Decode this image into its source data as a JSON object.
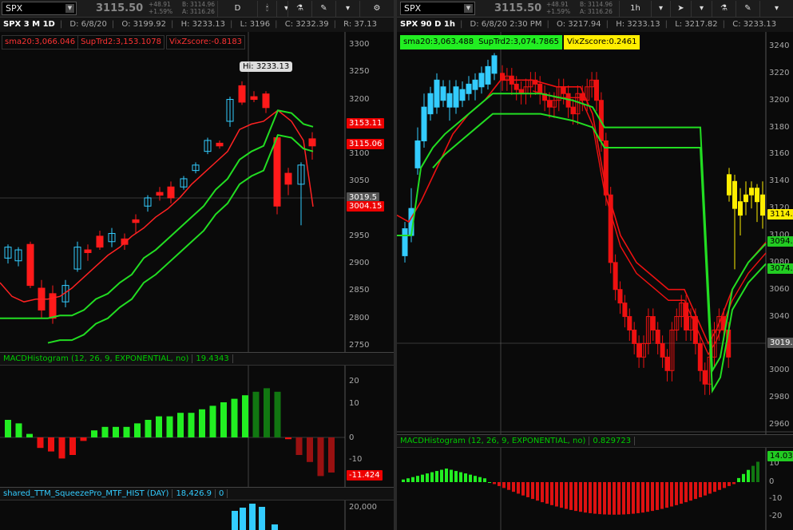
{
  "left": {
    "symbol": "SPX",
    "last": "3115.50",
    "change": "+48.91",
    "change_pct": "+1.59%",
    "bid": "B: 3114.96",
    "ask": "A: 3116.26",
    "timeframe_btn": "D",
    "info": {
      "title": "SPX 3 M 1D",
      "date": "D: 6/8/20",
      "open": "O: 3199.92",
      "high": "H: 3233.13",
      "low": "L: 3196",
      "close": "C: 3232.39",
      "range": "R: 37.13"
    },
    "labels": {
      "sma": "sma20:3,066.046",
      "suptrd": "SupTrd2:3,153.1078",
      "vix": "VixZscore:-0.8183"
    },
    "hi_label": "Hi: 3233.13",
    "price_labels": [
      "3153.11",
      "3115.06",
      "3019.5",
      "3004.15"
    ],
    "y_axis": [
      "3300",
      "3250",
      "3200",
      "3150",
      "3100",
      "3050",
      "3000",
      "2950",
      "2900",
      "2850",
      "2800",
      "2750"
    ],
    "macd": {
      "label": "MACDHistogram (12, 26, 9, EXPONENTIAL, no)",
      "value": "19.4343",
      "axis": [
        "20",
        "10",
        "0",
        "-10"
      ],
      "last_label": "-11.424"
    },
    "squeeze": {
      "label": "shared_TTM_SqueezePro_MTF_HIST (DAY)",
      "v1": "18,426.9",
      "v2": "0",
      "axis": "20,000"
    },
    "colors": {
      "up": "#33ccff",
      "down": "#ff1a1a",
      "supertrend": "#22dd22",
      "sma": "#ff2222"
    }
  },
  "right": {
    "symbol": "SPX",
    "last": "3115.50",
    "change": "+48.91",
    "change_pct": "+1.59%",
    "bid": "B: 3114.96",
    "ask": "A: 3116.26",
    "timeframe_btn": "1h",
    "info": {
      "title": "SPX 90 D 1h",
      "date": "D: 6/8/20 2:30 PM",
      "open": "O: 3217.94",
      "high": "H: 3233.13",
      "low": "L: 3217.82",
      "close": "C: 3233.13"
    },
    "labels": {
      "sma": "sma20:3,063.488",
      "suptrd": "SupTrd2:3,074.7865",
      "vix": "VixZscore:0.2461"
    },
    "price_labels": [
      "3114.",
      "3094.",
      "3074.",
      "3019."
    ],
    "y_axis": [
      "3240",
      "3220",
      "3200",
      "3180",
      "3160",
      "3140",
      "3120",
      "3100",
      "3080",
      "3060",
      "3040",
      "3020",
      "3000",
      "2980",
      "2960"
    ],
    "macd": {
      "label": "MACDHistogram (12, 26, 9, EXPONENTIAL, no)",
      "value": "0.829723",
      "axis": [
        "10",
        "0",
        "-10",
        "-20"
      ],
      "last_label": "14.03"
    }
  }
}
